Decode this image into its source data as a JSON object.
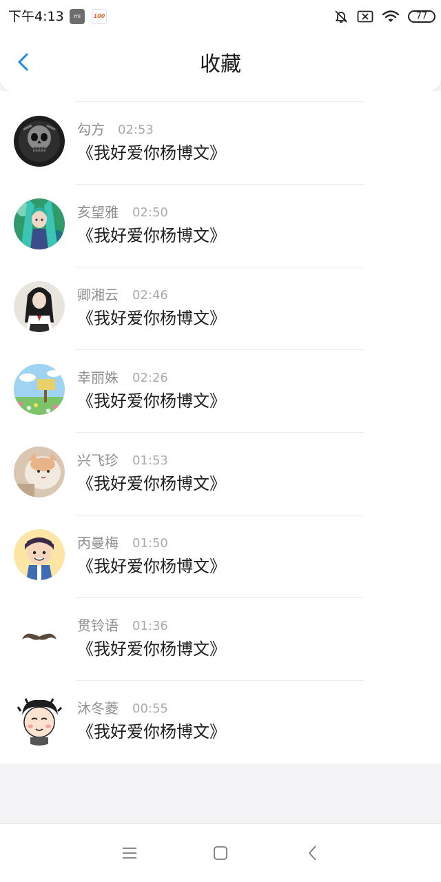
{
  "status_bar": {
    "time": "下午4:13",
    "battery": "77",
    "icons": [
      "mi-app-icon",
      "hundred-app-icon",
      "mute-bell-icon",
      "no-sim-icon",
      "wifi-icon",
      "battery-icon"
    ],
    "mi_label": "mi",
    "hundred_label": "100"
  },
  "header": {
    "title": "收藏",
    "back_icon": "chevron-left-icon",
    "accent": "#1e88e5"
  },
  "favorites": [
    {
      "name": "勾方",
      "time": "02:53",
      "content": "《我好爱你杨博文》",
      "avatar": "skull-avatar"
    },
    {
      "name": "亥望雅",
      "time": "02:50",
      "content": "《我好爱你杨博文》",
      "avatar": "anime-girl-avatar"
    },
    {
      "name": "卿湘云",
      "time": "02:46",
      "content": "《我好爱你杨博文》",
      "avatar": "schoolgirl-avatar"
    },
    {
      "name": "幸丽姝",
      "time": "02:26",
      "content": "《我好爱你杨博文》",
      "avatar": "meadow-sign-avatar"
    },
    {
      "name": "兴飞珍",
      "time": "01:53",
      "content": "《我好爱你杨博文》",
      "avatar": "cat-avatar"
    },
    {
      "name": "丙曼梅",
      "time": "01:50",
      "content": "《我好爱你杨博文》",
      "avatar": "cartoon-boy-avatar"
    },
    {
      "name": "贯铃语",
      "time": "01:36",
      "content": "《我好爱你杨博文》",
      "avatar": "mustache-avatar"
    },
    {
      "name": "沐冬菱",
      "time": "00:55",
      "content": "《我好爱你杨博文》",
      "avatar": "cartoon-face-avatar"
    }
  ],
  "nav_bar": {
    "icons": [
      "menu-icon",
      "home-square-icon",
      "back-triangle-icon"
    ]
  }
}
